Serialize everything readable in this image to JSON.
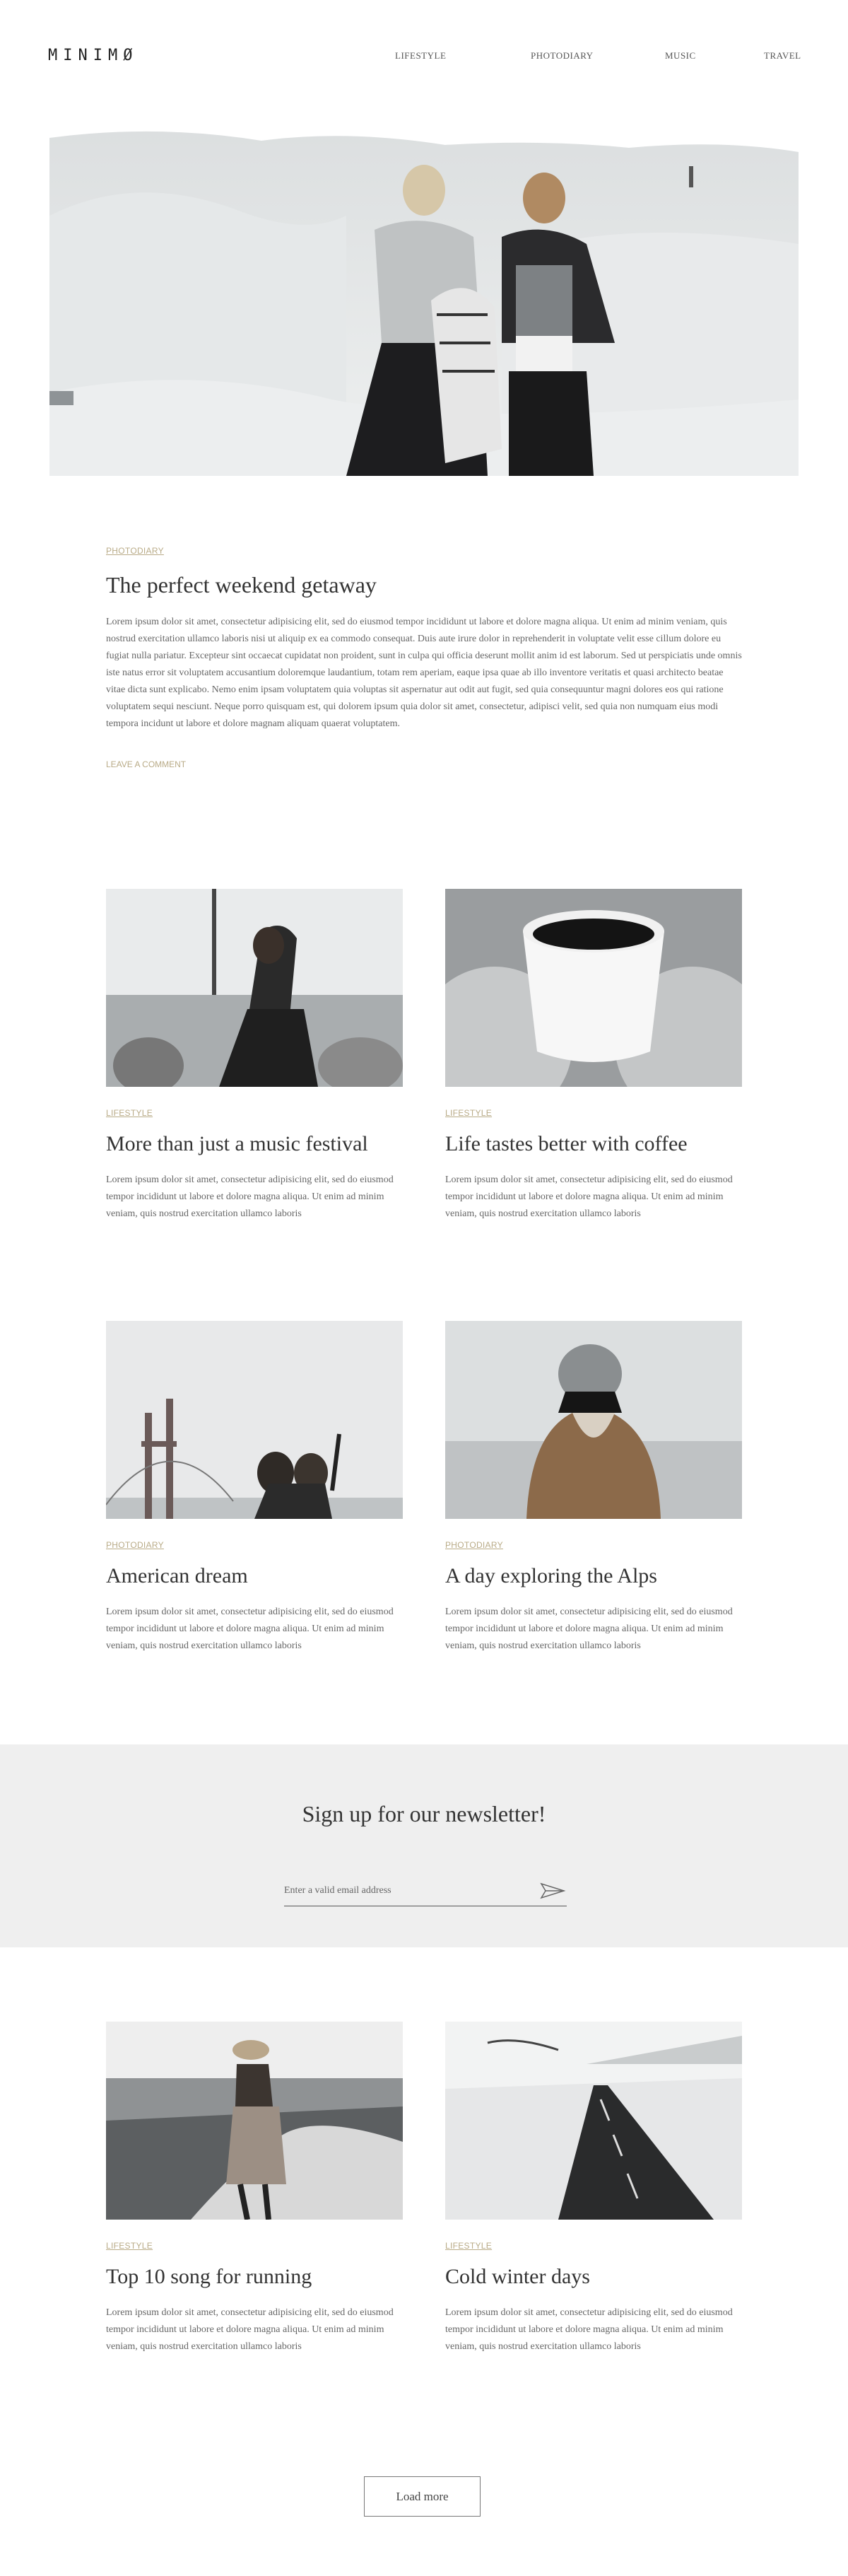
{
  "brand": {
    "logo": "MINIMØ"
  },
  "nav": {
    "items": [
      {
        "label": "LIFESTYLE"
      },
      {
        "label": "PHOTODIARY"
      },
      {
        "label": "MUSIC"
      },
      {
        "label": "TRAVEL"
      }
    ]
  },
  "featured": {
    "category": "PHOTODIARY",
    "title": "The perfect weekend getaway",
    "body": "Lorem ipsum dolor sit amet, consectetur adipisicing elit, sed do eiusmod tempor incididunt ut labore et dolore magna aliqua. Ut enim ad minim veniam, quis nostrud exercitation ullamco laboris nisi ut aliquip ex ea commodo consequat. Duis aute irure dolor in reprehenderit in voluptate velit esse cillum dolore eu fugiat nulla pariatur. Excepteur sint occaecat cupidatat non proident, sunt in culpa qui officia deserunt mollit anim id est laborum. Sed ut perspiciatis unde omnis iste natus error sit voluptatem accusantium doloremque laudantium, totam rem aperiam, eaque ipsa quae ab illo inventore veritatis et quasi architecto beatae vitae dicta sunt explicabo. Nemo enim ipsam voluptatem quia voluptas sit aspernatur aut odit aut fugit, sed quia consequuntur magni dolores eos qui ratione voluptatem sequi nesciunt. Neque porro quisquam est, qui dolorem ipsum quia dolor sit amet, consectetur, adipisci velit, sed quia non numquam eius modi tempora incidunt ut labore et dolore magnam aliquam quaerat voluptatem.",
    "comment_link": "LEAVE A COMMENT"
  },
  "posts": [
    {
      "category": "LIFESTYLE",
      "title": "More than just a music festival",
      "excerpt": "Lorem ipsum dolor sit amet, consectetur adipisicing elit, sed do eiusmod tempor incididunt ut labore et dolore magna aliqua. Ut enim ad minim veniam, quis nostrud exercitation ullamco laboris"
    },
    {
      "category": "LIFESTYLE",
      "title": "Life tastes better with coffee",
      "excerpt": "Lorem ipsum dolor sit amet, consectetur adipisicing elit, sed do eiusmod tempor incididunt ut labore et dolore magna aliqua. Ut enim ad minim veniam, quis nostrud exercitation ullamco laboris"
    },
    {
      "category": "PHOTODIARY",
      "title": "American dream",
      "excerpt": "Lorem ipsum dolor sit amet, consectetur adipisicing elit, sed do eiusmod tempor incididunt ut labore et dolore magna aliqua. Ut enim ad minim veniam, quis nostrud exercitation ullamco laboris"
    },
    {
      "category": "PHOTODIARY",
      "title": "A day exploring the Alps",
      "excerpt": "Lorem ipsum dolor sit amet, consectetur adipisicing elit, sed do eiusmod tempor incididunt ut labore et dolore magna aliqua. Ut enim ad minim veniam, quis nostrud exercitation ullamco laboris"
    },
    {
      "category": "LIFESTYLE",
      "title": "Top 10 song for running",
      "excerpt": "Lorem ipsum dolor sit amet, consectetur adipisicing elit, sed do eiusmod tempor incididunt ut labore et dolore magna aliqua. Ut enim ad minim veniam, quis nostrud exercitation ullamco laboris"
    },
    {
      "category": "LIFESTYLE",
      "title": "Cold winter days",
      "excerpt": "Lorem ipsum dolor sit amet, consectetur adipisicing elit, sed do eiusmod tempor incididunt ut labore et dolore magna aliqua. Ut enim ad minim veniam, quis nostrud exercitation ullamco laboris"
    }
  ],
  "newsletter": {
    "heading": "Sign up for our newsletter!",
    "placeholder": "Enter a valid email address",
    "submit_icon": "paper-plane-icon"
  },
  "load_more": {
    "label": "Load more"
  },
  "colors": {
    "accent": "#b9ab87",
    "newsletter_bg": "#efefef",
    "text": "#333333"
  }
}
